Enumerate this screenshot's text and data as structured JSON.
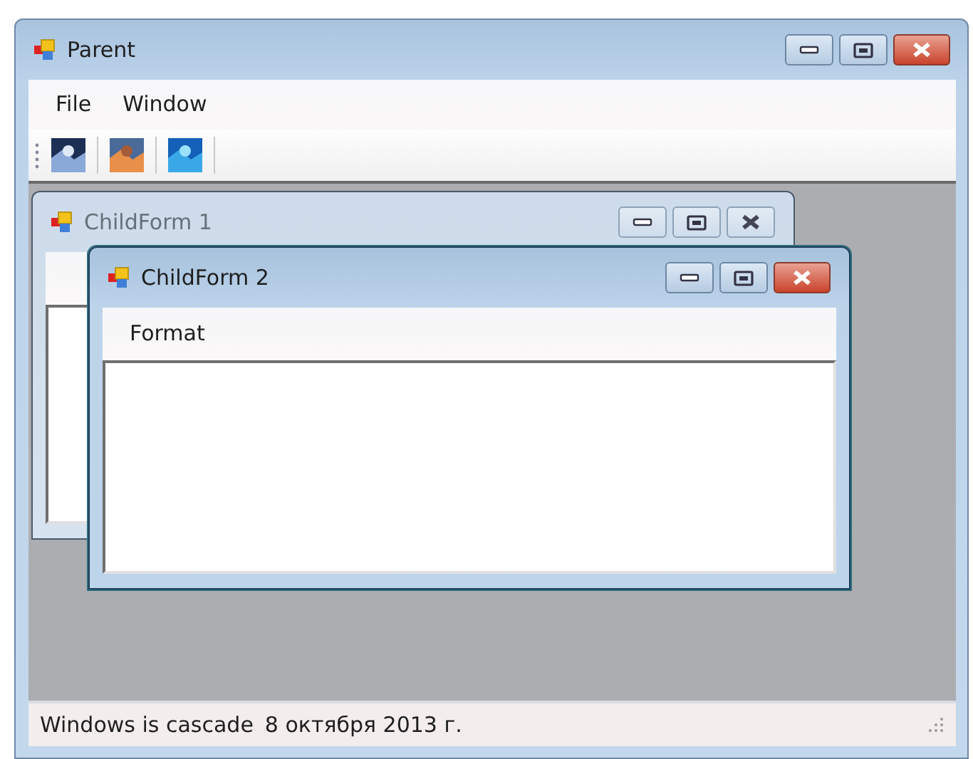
{
  "window": {
    "title": "Parent"
  },
  "menu": [
    {
      "label": "File"
    },
    {
      "label": "Window"
    }
  ],
  "children": [
    {
      "title": "ChildForm 1",
      "active": false
    },
    {
      "title": "ChildForm 2",
      "active": true,
      "menu": [
        {
          "label": "Format"
        }
      ]
    }
  ],
  "status_bar": [
    {
      "text": "Windows is cascade"
    },
    {
      "text": "8 октября 2013 г."
    }
  ]
}
